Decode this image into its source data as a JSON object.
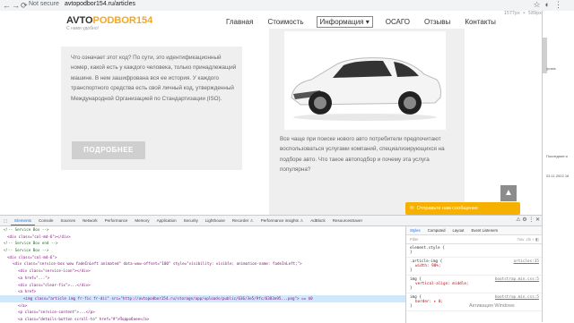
{
  "browser": {
    "security_label": "Not secure",
    "url": "avtopodbor154.ru/articles"
  },
  "site": {
    "logo_main": "AVTO",
    "logo_brand": "PODBOR154",
    "logo_sub": "С нами удобно!",
    "viewport_size": "1577px × 589px",
    "nav": [
      {
        "label": "Главная"
      },
      {
        "label": "Стоимость"
      },
      {
        "label": "Информация ▾"
      },
      {
        "label": "ОСАГО"
      },
      {
        "label": "Отзывы"
      },
      {
        "label": "Контакты"
      }
    ],
    "left_card_text": "Что означает этот код? По сути, это идентификационный номер, какой есть у каждого человека, только принадлежащий машине. В нем зашифрована вся ее история. У каждого транспортного средства есть свой личный код, утвержденный Международной Организацией по Стандартизации (ISO).",
    "left_button": "ПОДРОБНЕЕ",
    "right_card_text": "Все чаще при поиске нового авто потребители предпочитают воспользоваться услугами компаний, специализирующихся на подборе авто. Что такое автоподбор и почему эта услуга популярна?",
    "scroll_top_glyph": "▲",
    "chat_text": "Отправьте нам сообщение"
  },
  "right_window": {
    "lines": [
      "/posts",
      "Последние и",
      "03.11.2022 16"
    ]
  },
  "devtools": {
    "tabs": [
      "Elements",
      "Console",
      "Sources",
      "Network",
      "Performance",
      "Memory",
      "Application",
      "Security",
      "Lighthouse",
      "Recorder ⚠",
      "Performance insights ⚠",
      "AdBlock",
      "ResourcesSaver"
    ],
    "selected_tab": "Elements",
    "lines": [
      "<!-- Service Box -->",
      "<div class=\"col-md-6\"></div>",
      "<!-- Service Box end -->",
      "<!-- Service Box -->",
      "<div class=\"col-md-6\">",
      "<div class=\"service-box wow fadeInLeft animated\" data-wow-offset=\"100\" style=\"visibility: visible; animation-name: fadeInLeft;\">",
      "<div class=\"service-icon\"></div>",
      "<a href=\"...\">",
      "<div class=\"clear-fix\">...</div>",
      "<a href>",
      "<img class=\"article img fr-fic fr-dii\" src=\"http://avtopodbor154.ru/storage/app/uploads/public/636/3e5/9fc/6383e95...png\"> == $0",
      "</a>",
      "<p class=\"service-content\">...</p>",
      "<a class=\"details-button scroll-to\" href=\"#\">Подробнее</a>"
    ],
    "styles_tabs": [
      "Styles",
      "Computed",
      "Layout",
      "Event Listeners"
    ],
    "filter_placeholder": "Filter",
    "filter_hint": ":hov .cls + ◧",
    "rules": [
      {
        "selector": "element.style {",
        "source": "",
        "props": [
          "}"
        ]
      },
      {
        "selector": ".article-img {",
        "source": "articles:35",
        "props": [
          "width: 90%;",
          "}"
        ]
      },
      {
        "selector": "img {",
        "source": "bootstrap.min.css:5",
        "props": [
          "vertical-align: middle;",
          "}"
        ]
      },
      {
        "selector": "img {",
        "source": "bootstrap.min.css:5",
        "props": [
          "border: ▸ 0;",
          "}"
        ]
      }
    ]
  },
  "watermark": {
    "line1": "Активация Windows",
    "line2": "Чтобы активировать Windows, перейдите в раздел «Параметры»."
  }
}
